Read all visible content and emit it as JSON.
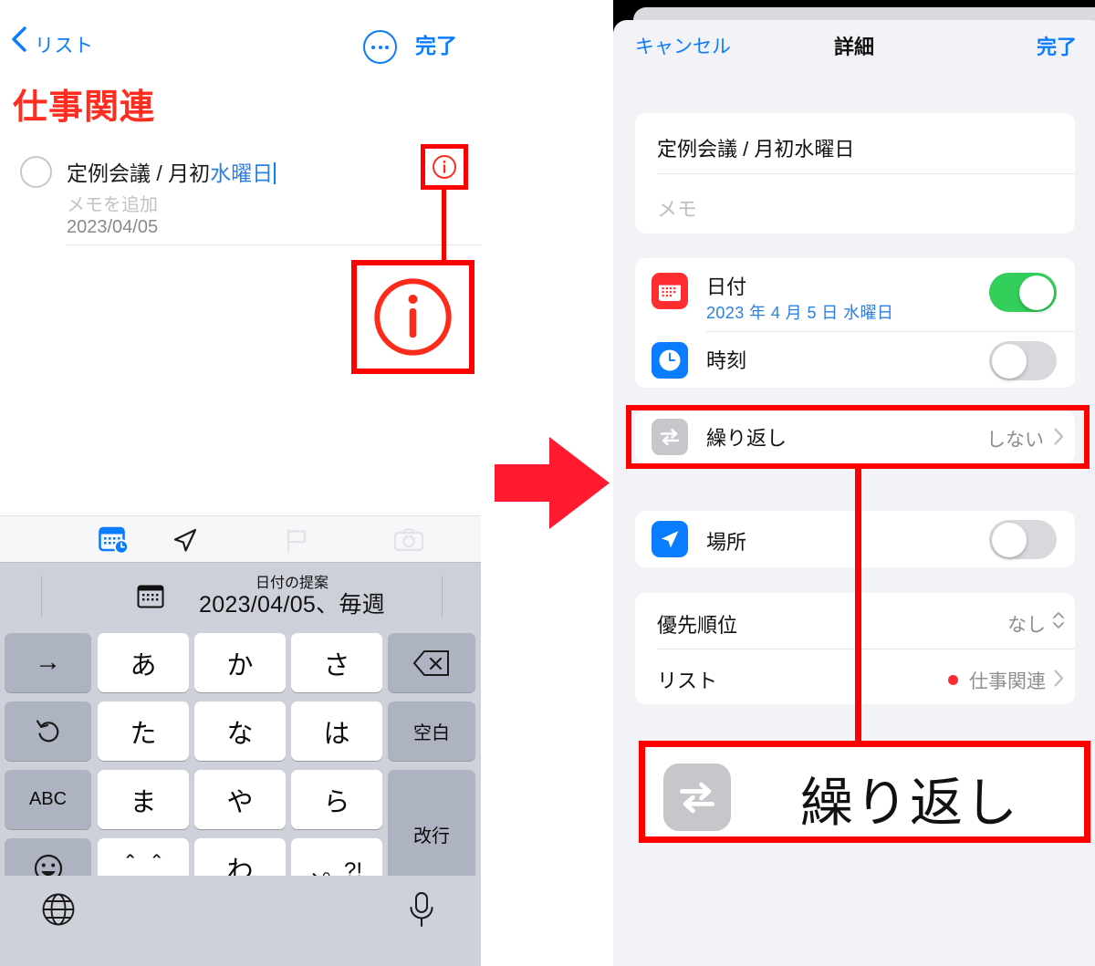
{
  "left_screen": {
    "nav": {
      "back_label": "リスト",
      "back_icon": "chevron-left-icon",
      "more_icon": "ellipsis-circle-icon",
      "done_label": "完了"
    },
    "list_title": "仕事関連",
    "reminder": {
      "title_plain": "定例会議 / 月初",
      "title_highlight": "水曜日",
      "note_placeholder": "メモを追加",
      "date": "2023/04/05",
      "info_icon": "info-circle-icon"
    },
    "keyboard_toolbar": [
      {
        "name": "calendar-clock-icon",
        "state": "active"
      },
      {
        "name": "location-arrow-icon",
        "state": "normal"
      },
      {
        "name": "flag-icon",
        "state": "disabled"
      },
      {
        "name": "camera-icon",
        "state": "disabled"
      }
    ],
    "suggestion": {
      "icon": "calendar-icon",
      "heading": "日付の提案",
      "value": "2023/04/05、毎週"
    },
    "keyboard": {
      "rows": [
        [
          {
            "label": "→",
            "type": "dark"
          },
          {
            "label": "あ",
            "type": "light"
          },
          {
            "label": "か",
            "type": "light"
          },
          {
            "label": "さ",
            "type": "light"
          },
          {
            "label": "⌫",
            "type": "dark",
            "icon": "delete-key-icon"
          }
        ],
        [
          {
            "label": "↺",
            "type": "dark",
            "icon": "undo-key-icon"
          },
          {
            "label": "た",
            "type": "light"
          },
          {
            "label": "な",
            "type": "light"
          },
          {
            "label": "は",
            "type": "light"
          },
          {
            "label": "空白",
            "type": "dark"
          }
        ],
        [
          {
            "label": "ABC",
            "type": "dark"
          },
          {
            "label": "ま",
            "type": "light"
          },
          {
            "label": "や",
            "type": "light"
          },
          {
            "label": "ら",
            "type": "light"
          },
          {
            "label": "改行",
            "type": "dark"
          }
        ],
        [
          {
            "label": "☺",
            "type": "dark",
            "icon": "emoji-key-icon"
          },
          {
            "label": "＾＾",
            "type": "light"
          },
          {
            "label": "わ",
            "type": "light"
          },
          {
            "label": "、。?!",
            "type": "light"
          }
        ]
      ],
      "globe_icon": "globe-icon",
      "mic_icon": "microphone-icon"
    }
  },
  "center": {
    "arrow_icon": "right-arrow-icon",
    "arrow_color": "#ff1a30"
  },
  "right_screen": {
    "nav": {
      "cancel_label": "キャンセル",
      "title": "詳細",
      "done_label": "完了"
    },
    "detail_card": {
      "title_value": "定例会議 / 月初水曜日",
      "memo_placeholder": "メモ"
    },
    "date_card": [
      {
        "icon": "calendar-icon",
        "icon_color": "#ff2d30",
        "label": "日付",
        "sublabel": "2023 年 4 月 5 日 水曜日",
        "toggle": "on"
      },
      {
        "icon": "clock-icon",
        "icon_color": "#0a7cff",
        "label": "時刻",
        "sublabel": "",
        "toggle": "off"
      }
    ],
    "repeat_cell": {
      "icon": "repeat-icon",
      "icon_color": "#c6c6cb",
      "label": "繰り返し",
      "value": "しない",
      "chevron": "chevron-right-icon"
    },
    "location_cell": {
      "icon": "location-arrow-icon",
      "icon_color": "#0a7cff",
      "label": "場所",
      "toggle": "off"
    },
    "meta_card": [
      {
        "label": "優先順位",
        "value": "なし",
        "accessory": "up-down-chevron-icon"
      },
      {
        "label": "リスト",
        "value": "仕事関連",
        "dot_color": "#ff2d30",
        "accessory": "chevron-right-icon"
      }
    ],
    "callout": {
      "icon": "repeat-icon",
      "label": "繰り返し",
      "highlight_color": "#ff0000"
    }
  }
}
